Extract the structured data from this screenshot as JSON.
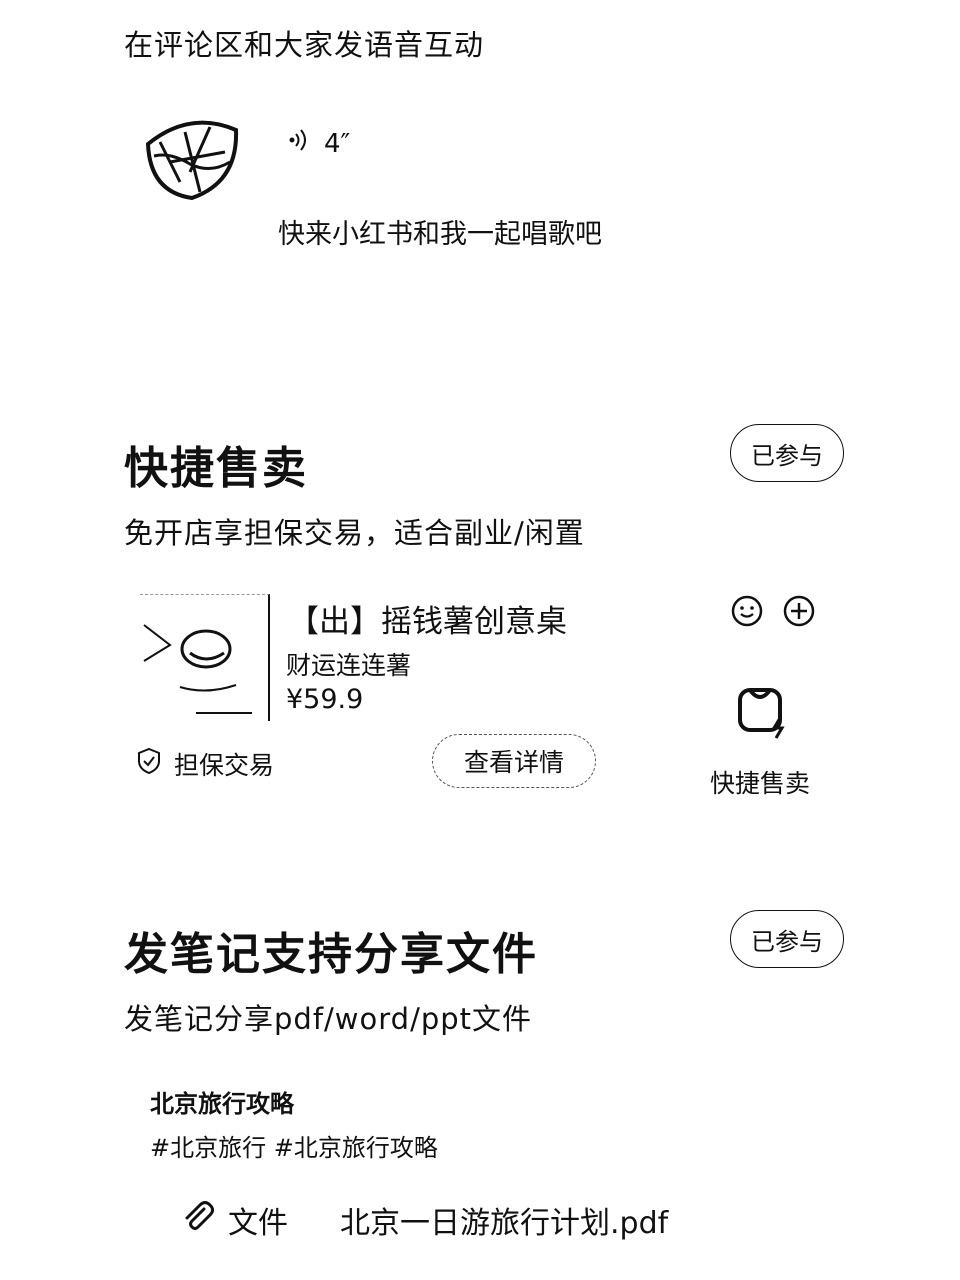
{
  "intro": {
    "text": "在评论区和大家发语音互动"
  },
  "voice": {
    "duration": "4″",
    "caption": "快来小红书和我一起唱歌吧"
  },
  "quick_sell": {
    "title": "快捷售卖",
    "subtitle": "免开店享担保交易，适合副业/闲置",
    "joined_label": "已参与",
    "product": {
      "title": "【出】摇钱薯创意桌",
      "subtitle": "财运连连薯",
      "price": "¥59.9"
    },
    "guarantee_label": "担保交易",
    "detail_button": "查看详情",
    "side_label": "快捷售卖"
  },
  "note_file": {
    "title": "发笔记支持分享文件",
    "subtitle": "发笔记分享pdf/word/ppt文件",
    "joined_label": "已参与",
    "note": {
      "title": "北京旅行攻略",
      "tags": "#北京旅行 #北京旅行攻略"
    },
    "file_label": "文件",
    "file_name": "北京一日游旅行计划.pdf"
  },
  "icons": [
    "sound-wave-icon",
    "smile-icon",
    "plus-circle-icon",
    "shopping-bag-icon",
    "shield-check-icon",
    "paperclip-icon"
  ]
}
